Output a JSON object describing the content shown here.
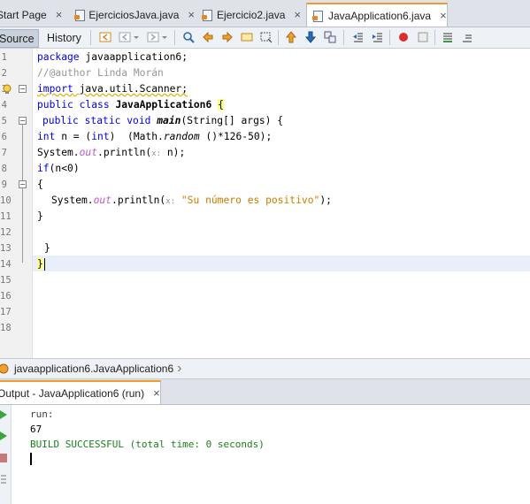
{
  "tabs": [
    {
      "label": "Start Page",
      "close": "×"
    },
    {
      "label": "EjerciciosJava.java",
      "close": "×"
    },
    {
      "label": "Ejercicio2.java",
      "close": "×"
    },
    {
      "label": "JavaApplication6.java",
      "close": "×",
      "active": true
    }
  ],
  "toolbar": {
    "source_label": "Source",
    "history_label": "History"
  },
  "editor": {
    "line_numbers": [
      "1",
      "2",
      "3",
      "4",
      "5",
      "6",
      "7",
      "8",
      "9",
      "10",
      "11",
      "12",
      "13",
      "14",
      "15",
      "16",
      "17",
      "18"
    ],
    "lines": {
      "l1_kw": "package",
      "l1_rest": " javaapplication6;",
      "l2": "//@author Linda Morán",
      "l3_kw": "import",
      "l3_rest": " java.util.Scanner;",
      "l4_kw": "public class",
      "l4_name": "JavaApplication6",
      "l4_brace": "{",
      "l5_kw": "public static void",
      "l5_main": "main",
      "l5_rest": "(String[] args) {",
      "l6_kw1": "int",
      "l6_a": " n = (",
      "l6_kw2": "int",
      "l6_b": ")  (Math.",
      "l6_rand": "random",
      "l6_c": " ()*126-50);",
      "l7_a": "System.",
      "l7_out": "out",
      "l7_b": ".println(",
      "l7_hint": "x:",
      "l7_c": " n);",
      "l8_kw": "if",
      "l8_rest": "(n<0)",
      "l9": "{",
      "l10_a": "System.",
      "l10_out": "out",
      "l10_b": ".println(",
      "l10_hint": "x:",
      "l10_str": " \"Su número es positivo\"",
      "l10_c": ");",
      "l11": "}",
      "l13": "}",
      "l14": "}"
    }
  },
  "breadcrumb": {
    "path": "javaapplication6.JavaApplication6",
    "arrow": "›"
  },
  "output_panel": {
    "tab_label": "Output - JavaApplication6 (run)",
    "close": "×",
    "lines": [
      "run:",
      "67",
      "BUILD SUCCESSFUL (total time: 0 seconds)"
    ]
  },
  "colors": {
    "keyword": "#0000e6",
    "comment": "#969696",
    "field": "#b55ad2",
    "string": "#ce7b00",
    "success": "#1a7f1a",
    "active_tab_accent": "#f39a2c"
  }
}
